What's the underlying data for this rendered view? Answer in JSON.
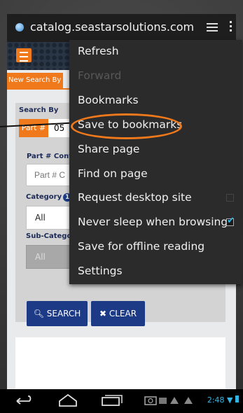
{
  "browser": {
    "url": "catalog.seastarsolutions.com"
  },
  "site": {
    "nav_tab_label": "New Search By"
  },
  "search_form": {
    "search_by_label": "Search By",
    "part_button_label": "Part #",
    "part_value": "05",
    "part_contains_label": "Part # Conta",
    "part_input_placeholder": "Part # C",
    "category_label": "Category",
    "category_badge": "1",
    "category_value": "All",
    "subcategory_label": "Sub-Catego",
    "subcategory_value": "All",
    "search_button_label": "SEARCH",
    "clear_button_label": "CLEAR"
  },
  "menu": {
    "items": [
      {
        "label": "Refresh",
        "enabled": true
      },
      {
        "label": "Forward",
        "enabled": false
      },
      {
        "label": "Bookmarks",
        "enabled": true
      },
      {
        "label": "Save to bookmarks",
        "enabled": true,
        "highlighted": true
      },
      {
        "label": "Share page",
        "enabled": true
      },
      {
        "label": "Find on page",
        "enabled": true
      },
      {
        "label": "Request desktop site",
        "enabled": true,
        "checkbox": false
      },
      {
        "label": "Never sleep when browsing",
        "enabled": true,
        "checkbox": true
      },
      {
        "label": "Save for offline reading",
        "enabled": true
      },
      {
        "label": "Settings",
        "enabled": true
      }
    ]
  },
  "status_bar": {
    "time": "2:48"
  },
  "colors": {
    "accent_orange": "#f0791b",
    "button_blue": "#1c3a86",
    "menu_bg": "#2b2b2b",
    "checkbox_blue": "#33b5e5"
  }
}
